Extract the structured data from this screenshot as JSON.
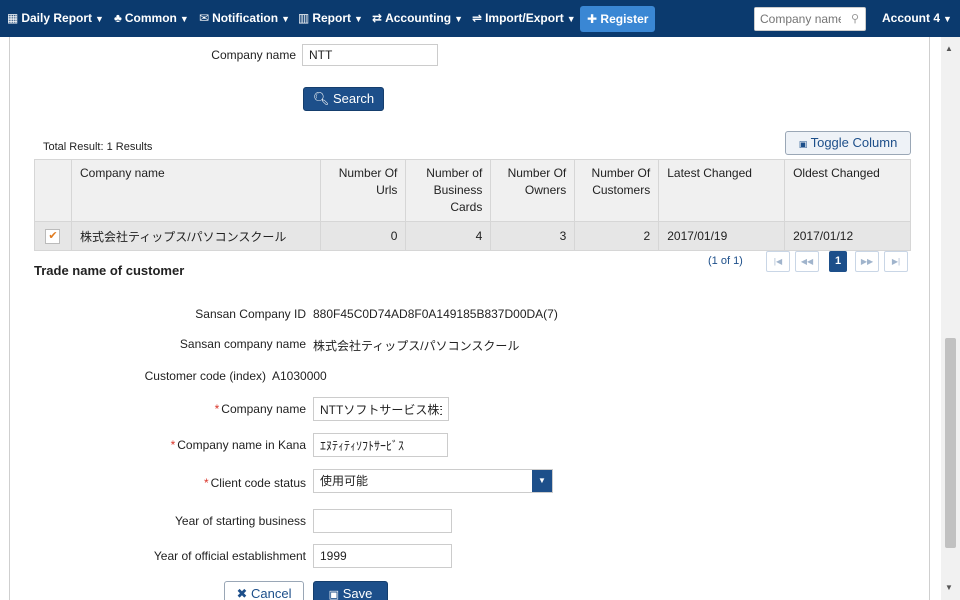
{
  "nav": {
    "items": [
      {
        "icon": "calendar-icon",
        "glyph": "▦",
        "label": "Daily Report"
      },
      {
        "icon": "users-icon",
        "glyph": "♣",
        "label": "Common"
      },
      {
        "icon": "envelope-icon",
        "glyph": "✉",
        "label": "Notification"
      },
      {
        "icon": "bar-chart-icon",
        "glyph": "▥",
        "label": "Report"
      },
      {
        "icon": "exchange-icon",
        "glyph": "⇄",
        "label": "Accounting"
      },
      {
        "icon": "swap-icon",
        "glyph": "⇌",
        "label": "Import/Export"
      }
    ],
    "register_label": "Register",
    "search_placeholder": "Company name",
    "account_label": "Account 4"
  },
  "search_form": {
    "company_name_label": "Company name",
    "company_name_value": "NTT",
    "search_button": "Search"
  },
  "results": {
    "total_label": "Total Result: 1 Results",
    "toggle_column_button": "Toggle Column",
    "columns": [
      "Company name",
      "Number Of Urls",
      "Number of Business Cards",
      "Number Of Owners",
      "Number Of Customers",
      "Latest Changed",
      "Oldest Changed"
    ],
    "rows": [
      {
        "company_name": "株式会社ティップス/パソコンスクール",
        "urls": "0",
        "business_cards": "4",
        "owners": "3",
        "customers": "2",
        "latest_changed": "2017/01/19",
        "oldest_changed": "2017/01/12",
        "selected": true
      }
    ],
    "pagination": {
      "info": "(1 of 1)",
      "current_page": "1",
      "first": "|◀",
      "prev": "◀◀",
      "next": "▶▶",
      "last": "▶|"
    }
  },
  "detail": {
    "section_title": "Trade name of customer",
    "sansan_company_id_label": "Sansan Company ID",
    "sansan_company_id_value": "880F45C0D74AD8F0A149185B837D00DA(7)",
    "sansan_company_name_label": "Sansan company name",
    "sansan_company_name_value": "株式会社ティップス/パソコンスクール",
    "customer_code_label": "Customer code (index)",
    "customer_code_value": "A1030000",
    "company_name_label": "Company name",
    "company_name_value": "NTTソフトサービス株式会社",
    "company_name_kana_label": "Company name in Kana",
    "company_name_kana_value": "ｴﾇﾃｨﾃｨｿﾌﾄｻｰﾋﾞｽ",
    "client_code_status_label": "Client code status",
    "client_code_status_value": "使用可能",
    "year_starting_label": "Year of starting business",
    "year_starting_value": "",
    "year_established_label": "Year of official establishment",
    "year_established_value": "1999",
    "cancel_button": "Cancel",
    "save_button": "Save"
  },
  "colors": {
    "nav_bg": "#0b3a6e",
    "primary": "#1d4f8a",
    "register": "#3a87d4",
    "required": "#d9352a",
    "check": "#e07b20"
  }
}
